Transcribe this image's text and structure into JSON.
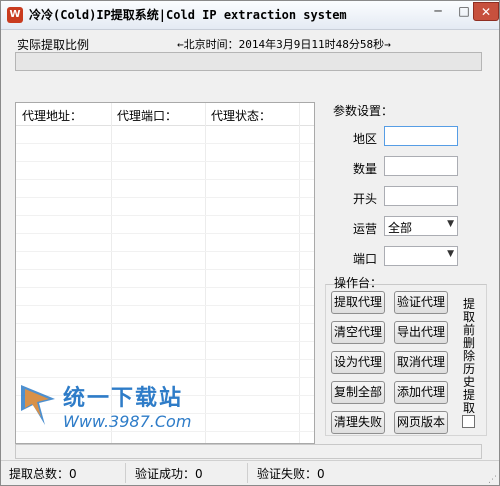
{
  "window": {
    "app_icon": "W",
    "title": "冷冷(Cold)IP提取系统|Cold IP extraction system",
    "minimize": "─",
    "maximize": "□",
    "close": "✕"
  },
  "header": {
    "ratio_label": "实际提取比例",
    "clock": "←北京时间：2014年3月9日11时48分58秒→"
  },
  "progress": {
    "value_percent": 0
  },
  "table": {
    "columns": [
      "代理地址：",
      "代理端口：",
      "代理状态："
    ],
    "rows": []
  },
  "params": {
    "title": "参数设置：",
    "region_label": "地区",
    "region_value": "",
    "quantity_label": "数量",
    "quantity_value": "",
    "prefix_label": "开头",
    "prefix_value": "",
    "carrier_label": "运营",
    "carrier_value": "全部",
    "port_label": "端口",
    "port_value": ""
  },
  "ops": {
    "title": "操作台：",
    "buttons": [
      "提取代理",
      "验证代理",
      "清空代理",
      "导出代理",
      "设为代理",
      "取消代理",
      "复制全部",
      "添加代理",
      "清理失败",
      "网页版本"
    ],
    "clear_before_label": "提取前删除历史提取",
    "clear_before_checked": false
  },
  "status": {
    "total": "提取总数：0",
    "success": "验证成功：0",
    "failed": "验证失败：0"
  },
  "watermark": {
    "brand": "统一下载站",
    "url": "Www.3987.Com"
  },
  "colors": {
    "close_button": "#c7503d",
    "focus_border": "#569de5",
    "watermark": "#2e7cc8"
  }
}
